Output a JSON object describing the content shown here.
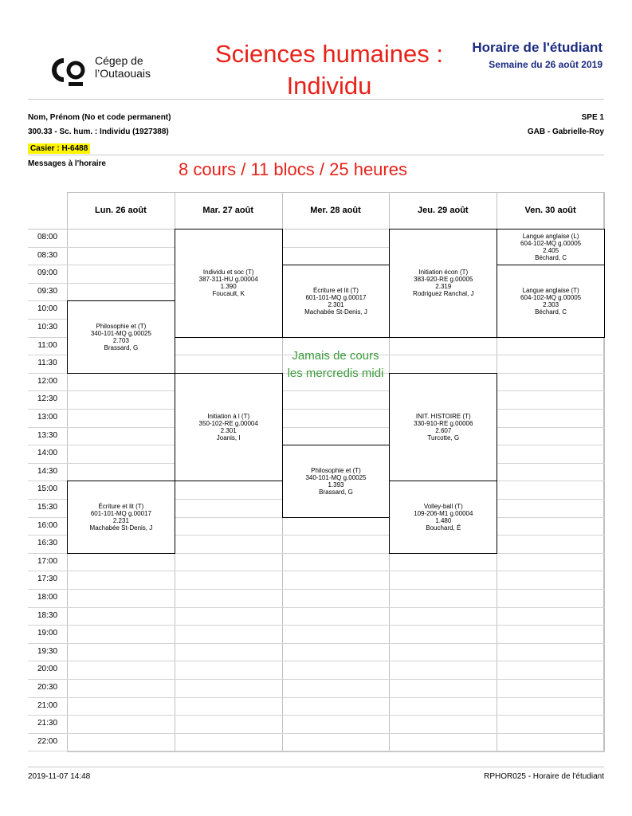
{
  "logo": {
    "line1": "Cégep de",
    "line2": "l’Outaouais"
  },
  "red_title": {
    "line1": "Sciences humaines :",
    "line2": "Individu"
  },
  "header": {
    "title": "Horaire de l'étudiant",
    "week": "Semaine du 26 août 2019"
  },
  "student": {
    "name_label": "Nom, Prénom (No et code permanent)",
    "program": "300.33 - Sc. hum. : Individu (1927388)",
    "group": "SPE 1",
    "campus": "GAB - Gabrielle-Roy",
    "casier": "Casier :  H-6488",
    "messages_label": "Messages à l'horaire"
  },
  "stats_note": "8 cours /  11 blocs / 25 heures",
  "green_note": "Jamais de cours les mercredis midi",
  "colors": {
    "red": "#e8221a",
    "navy": "#1b2a82",
    "highlight": "#fff500",
    "green": "#3a9a3a"
  },
  "days": [
    "Lun. 26 août",
    "Mar. 27 août",
    "Mer. 28 août",
    "Jeu. 29 août",
    "Ven. 30 août"
  ],
  "times": [
    "08:00",
    "08:30",
    "09:00",
    "09:30",
    "10:00",
    "10:30",
    "11:00",
    "11:30",
    "12:00",
    "12:30",
    "13:00",
    "13:30",
    "14:00",
    "14:30",
    "15:00",
    "15:30",
    "16:00",
    "16:30",
    "17:00",
    "17:30",
    "18:00",
    "18:30",
    "19:00",
    "19:30",
    "20:00",
    "20:30",
    "21:00",
    "21:30",
    "22:00"
  ],
  "courses": [
    {
      "day": 0,
      "start": "10:00",
      "end": "12:00",
      "lines": [
        "Philosophie et (T)",
        "340-101-MQ g.00025",
        "2.703",
        "Brassard, G"
      ]
    },
    {
      "day": 0,
      "start": "15:00",
      "end": "17:00",
      "lines": [
        "Écriture et lit (T)",
        "601-101-MQ g.00017",
        "2.231",
        "Machabée St-Denis, J"
      ]
    },
    {
      "day": 1,
      "start": "08:00",
      "end": "11:00",
      "lines": [
        "Individu et soc (T)",
        "387-311-HU g.00004",
        "1.390",
        "Foucault, K"
      ]
    },
    {
      "day": 1,
      "start": "12:00",
      "end": "15:00",
      "lines": [
        "Initiation à  l (T)",
        "350-102-RE g.00004",
        "2.301",
        "Joanis, I"
      ]
    },
    {
      "day": 2,
      "start": "09:00",
      "end": "11:00",
      "lines": [
        "Écriture et lit (T)",
        "601-101-MQ g.00017",
        "2.301",
        "Machabée St-Denis, J"
      ]
    },
    {
      "day": 2,
      "start": "14:00",
      "end": "16:00",
      "lines": [
        "Philosophie et (T)",
        "340-101-MQ g.00025",
        "1.393",
        "Brassard, G"
      ]
    },
    {
      "day": 3,
      "start": "08:00",
      "end": "11:00",
      "lines": [
        "Initiation écon (T)",
        "383-920-RE g.00005",
        "2.319",
        "Rodriguez Ranchal, J"
      ]
    },
    {
      "day": 3,
      "start": "12:00",
      "end": "15:00",
      "lines": [
        "INIT.  HISTOIRE (T)",
        "330-910-RE g.00006",
        "2.607",
        "Turcotte, G"
      ]
    },
    {
      "day": 3,
      "start": "15:00",
      "end": "17:00",
      "lines": [
        "Volley-ball (T)",
        "109-206-M1 g.00004",
        "1.480",
        "Bouchard, É"
      ]
    },
    {
      "day": 4,
      "start": "08:00",
      "end": "09:00",
      "lines": [
        "Langue anglaise (L)",
        "604-102-MQ g.00005",
        "2.405",
        "Béchard, C"
      ]
    },
    {
      "day": 4,
      "start": "09:00",
      "end": "11:00",
      "lines": [
        "Langue anglaise (T)",
        "604-102-MQ g.00005",
        "2.303",
        "Béchard, C"
      ]
    }
  ],
  "footer": {
    "left": "2019-11-07 14:48",
    "right": "RPHOR025 - Horaire de l'étudiant"
  }
}
